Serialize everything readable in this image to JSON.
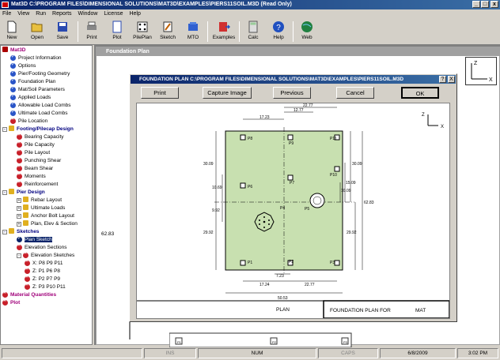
{
  "window": {
    "title": "Mat3D   C:\\PROGRAM FILES\\DIMENSIONAL SOLUTIONS\\MAT3D\\EXAMPLES\\PIERS11SOIL.M3D (Read Only)"
  },
  "menu": [
    "File",
    "View",
    "Run",
    "Reports",
    "Window",
    "License",
    "Help"
  ],
  "toolbar": [
    "New",
    "Open",
    "Save",
    "Print",
    "Plot",
    "PilePlan",
    "Sketch",
    "MTO",
    "Examples",
    "Calc",
    "Help",
    "Web"
  ],
  "tree": [
    {
      "label": "Mat3D",
      "icon": "m",
      "style": "mag",
      "level": 0
    },
    {
      "label": "Project Information",
      "icon": "ok",
      "level": 1
    },
    {
      "label": "Options",
      "icon": "ok",
      "level": 1
    },
    {
      "label": "Pier/Footing Geometry",
      "icon": "ok",
      "level": 1
    },
    {
      "label": "Foundation Plan",
      "icon": "ok",
      "level": 1
    },
    {
      "label": "Mat/Soil Parameters",
      "icon": "ok",
      "level": 1
    },
    {
      "label": "Applied Loads",
      "icon": "ok",
      "level": 1
    },
    {
      "label": "Allowable Load Combs",
      "icon": "ok",
      "level": 1
    },
    {
      "label": "Ultimate Load Combs",
      "icon": "ok",
      "level": 1
    },
    {
      "label": "Pile Location",
      "icon": "bad",
      "level": 1
    },
    {
      "label": "Footing/Pilecap Design",
      "icon": "dir",
      "style": "hdr",
      "pm": "-",
      "level": 0
    },
    {
      "label": "Bearing Capacity",
      "icon": "bad",
      "level": 2
    },
    {
      "label": "Pile Capacity",
      "icon": "bad",
      "level": 2
    },
    {
      "label": "Pile Layout",
      "icon": "bad",
      "level": 2
    },
    {
      "label": "Punching Shear",
      "icon": "bad",
      "level": 2
    },
    {
      "label": "Beam Shear",
      "icon": "bad",
      "level": 2
    },
    {
      "label": "Moments",
      "icon": "bad",
      "level": 2
    },
    {
      "label": "Reinforcement",
      "icon": "bad",
      "level": 2
    },
    {
      "label": "Pier Design",
      "icon": "dir",
      "style": "hdr",
      "pm": "-",
      "level": 0
    },
    {
      "label": "Rebar Layout",
      "icon": "dir",
      "pm": "+",
      "level": 2
    },
    {
      "label": "Ultimate Loads",
      "icon": "dir",
      "pm": "+",
      "level": 2
    },
    {
      "label": "Anchor Bolt Layout",
      "icon": "dir",
      "pm": "+",
      "level": 2
    },
    {
      "label": "Plan, Elev & Section",
      "icon": "dir",
      "pm": "+",
      "level": 2
    },
    {
      "label": "Sketches",
      "icon": "dir",
      "style": "hdr",
      "pm": "-",
      "level": 0
    },
    {
      "label": "Plan Sketch",
      "icon": "ok",
      "level": 2,
      "selected": true
    },
    {
      "label": "Elevation Sections",
      "icon": "bad",
      "level": 2
    },
    {
      "label": "Elevation Sketches",
      "icon": "bad",
      "pm": "-",
      "level": 2
    },
    {
      "label": "X: P8 P9 P11",
      "icon": "bad",
      "level": 3
    },
    {
      "label": "Z: P1 P6 P8",
      "icon": "bad",
      "level": 3
    },
    {
      "label": "Z: P2 P7 P9",
      "icon": "bad",
      "level": 3
    },
    {
      "label": "Z: P3 P10 P11",
      "icon": "bad",
      "level": 3
    },
    {
      "label": "Material Quantities",
      "icon": "bad",
      "style": "mag",
      "level": 0
    },
    {
      "label": "Plot",
      "icon": "bad",
      "style": "mag",
      "level": 0
    }
  ],
  "child": {
    "title": "Foundation Plan",
    "dim": "62.83",
    "axis_z": "Z",
    "axis_x": "X",
    "piles": [
      "P1",
      "P2",
      "P3"
    ]
  },
  "dialog": {
    "title": "FOUNDATION PLAN  C:\\PROGRAM FILES\\DIMENSIONAL SOLUTIONS\\MAT3D\\EXAMPLES\\PIERS11SOIL.M3D",
    "buttons": [
      "Print",
      "Capture Image",
      "Previous",
      "Cancel",
      "OK"
    ],
    "help": "?",
    "close": "X"
  },
  "plan": {
    "dims": {
      "top1": "22.77",
      "top2": "12.77",
      "top3": "17.23",
      "left1": "30.09",
      "left2": "10.69",
      "left3": "9.92",
      "left4": "29.92",
      "right1": "30.09",
      "right2": "15.09",
      "right3": "10.09",
      "right4": "29.92",
      "right5": "62.83",
      "bot1": "17.24",
      "bot2": "7.23",
      "bot3": "22.77",
      "bot4": "50.53"
    },
    "piles": [
      "P1",
      "P2",
      "P3",
      "P4",
      "P5",
      "P6",
      "P7",
      "P8",
      "P9",
      "P10",
      "P11"
    ],
    "label_plan": "PLAN",
    "label_title": "FOUNDATION PLAN FOR",
    "label_mat": "MAT",
    "axis_z": "Z",
    "axis_x": "X"
  },
  "status": {
    "ins": "INS",
    "num": "NUM",
    "caps": "CAPS",
    "date": "6/8/2009",
    "time": "3:02 PM"
  }
}
